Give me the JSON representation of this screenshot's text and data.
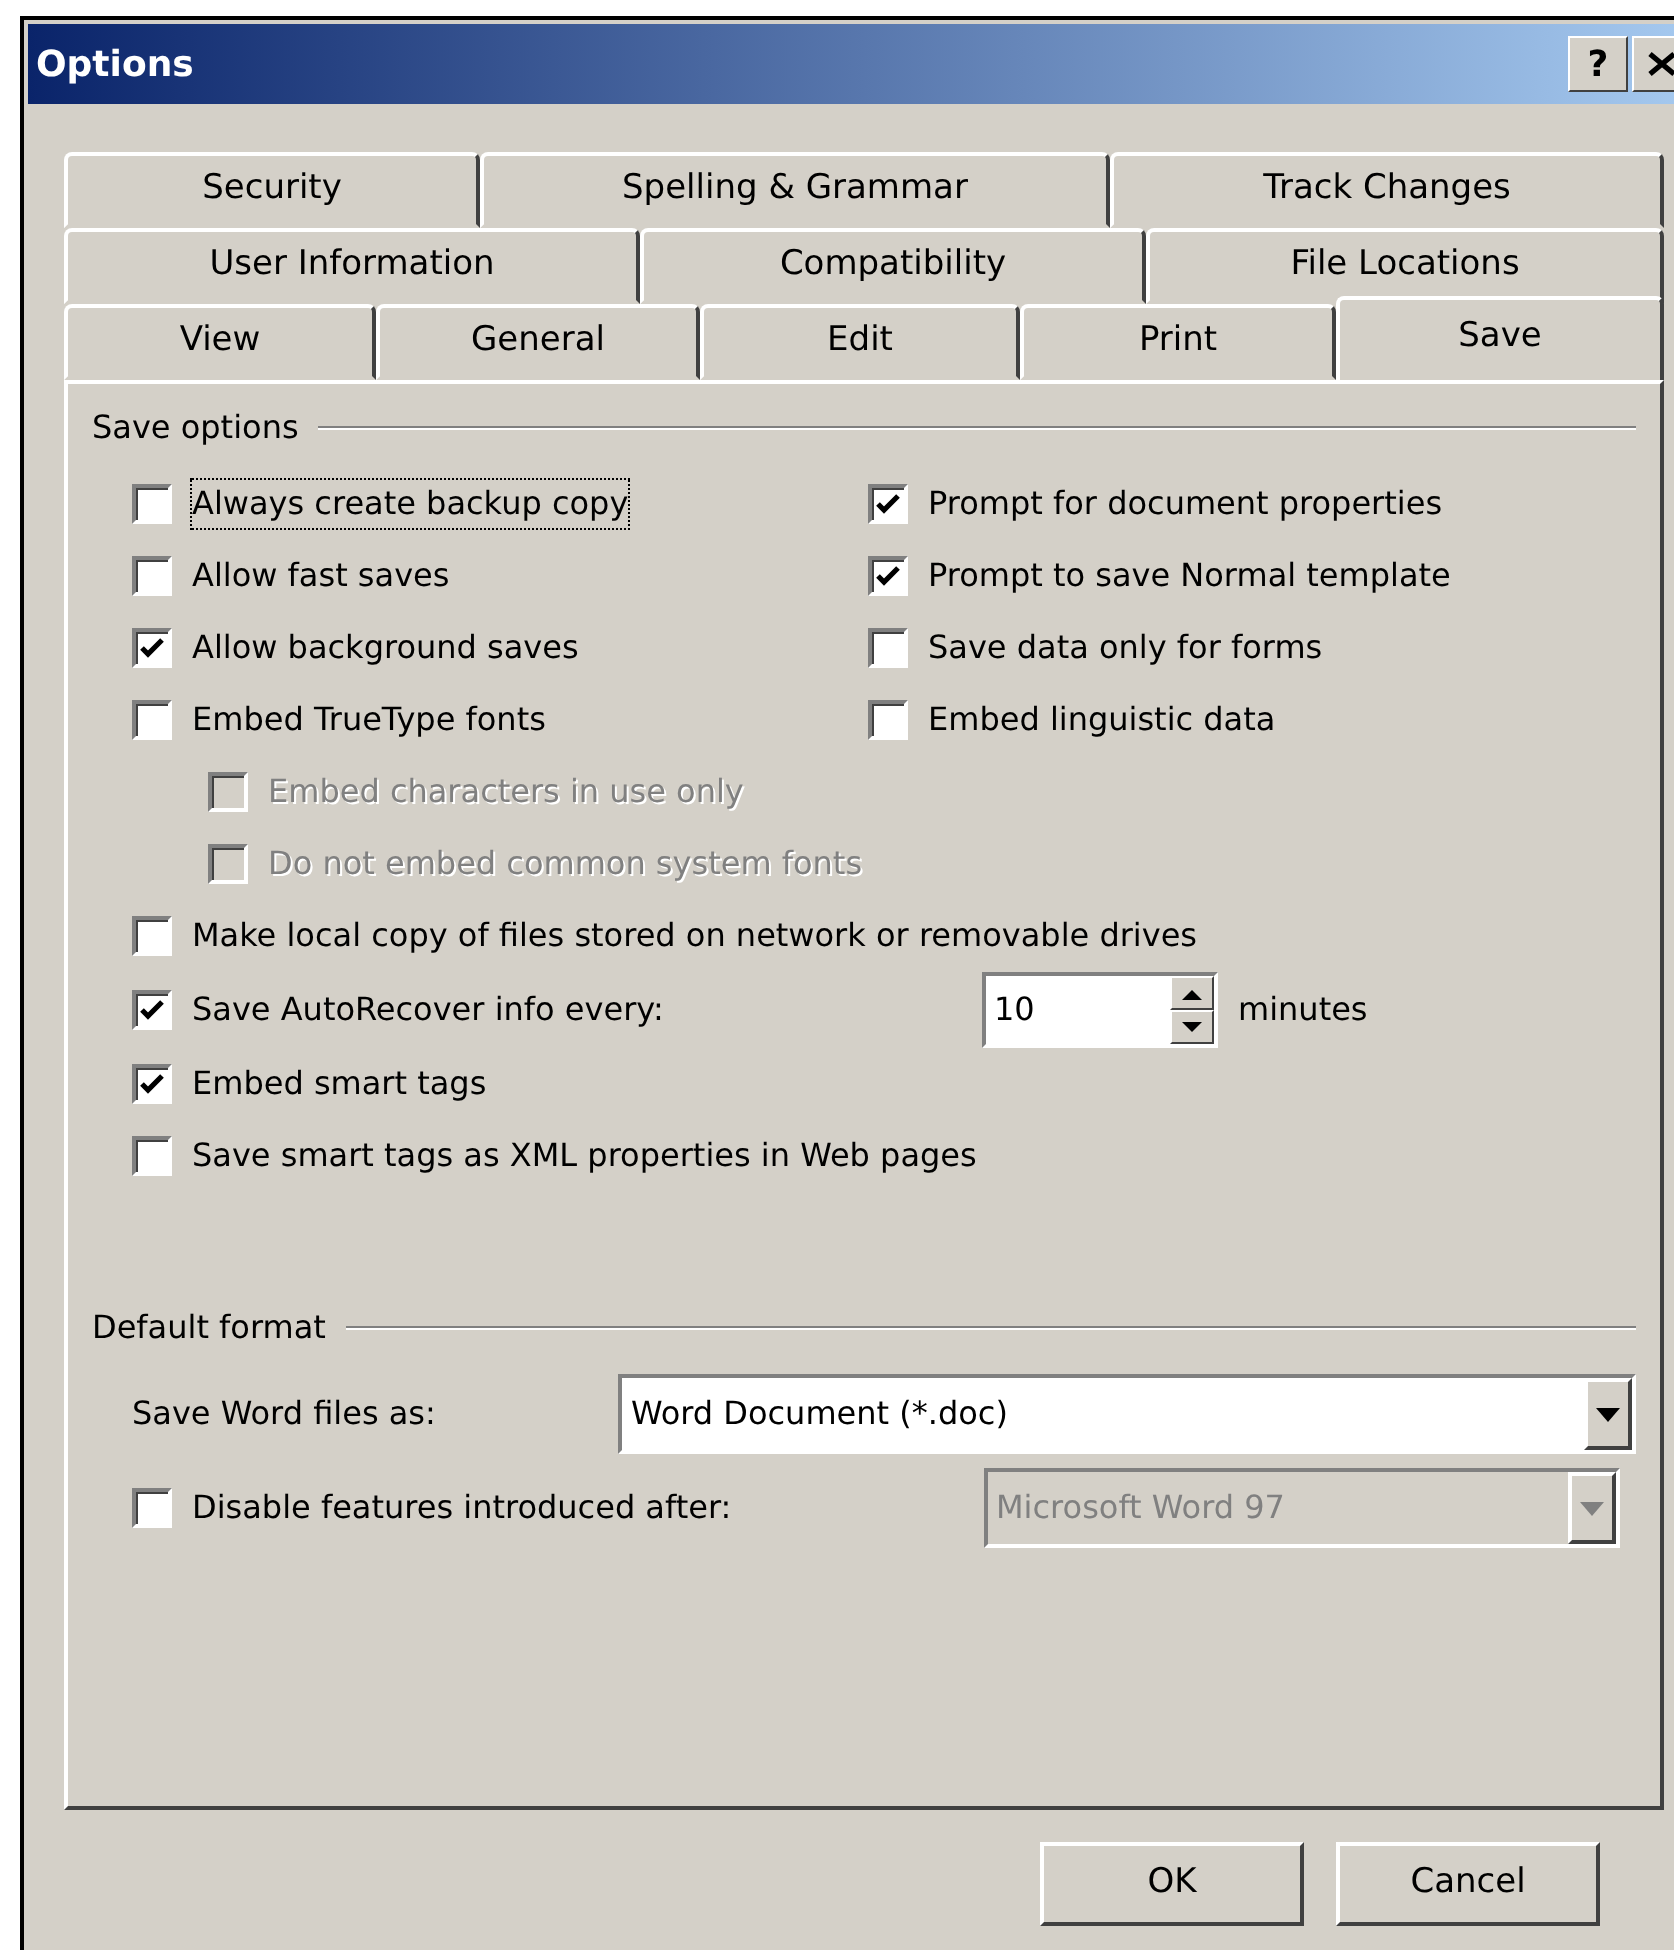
{
  "window": {
    "title": "Options",
    "help": "?"
  },
  "tab_rows": [
    [
      {
        "label": "Security",
        "selected": false
      },
      {
        "label": "Spelling & Grammar",
        "selected": false
      },
      {
        "label": "Track Changes",
        "selected": false
      }
    ],
    [
      {
        "label": "User Information",
        "selected": false
      },
      {
        "label": "Compatibility",
        "selected": false
      },
      {
        "label": "File Locations",
        "selected": false
      }
    ],
    [
      {
        "label": "View",
        "selected": false
      },
      {
        "label": "General",
        "selected": false
      },
      {
        "label": "Edit",
        "selected": false
      },
      {
        "label": "Print",
        "selected": false
      },
      {
        "label": "Save",
        "selected": true
      }
    ]
  ],
  "save_options": {
    "title": "Save options",
    "left": [
      {
        "label": "Always create backup copy",
        "checked": false,
        "disabled": false,
        "focused": true
      },
      {
        "label": "Allow fast saves",
        "checked": false,
        "disabled": false
      },
      {
        "label": "Allow background saves",
        "checked": true,
        "disabled": false
      },
      {
        "label": "Embed TrueType fonts",
        "checked": false,
        "disabled": false,
        "children": [
          {
            "label": "Embed characters in use only",
            "checked": false,
            "disabled": true
          },
          {
            "label": "Do not embed common system fonts",
            "checked": false,
            "disabled": true
          }
        ]
      }
    ],
    "right": [
      {
        "label": "Prompt for document properties",
        "checked": true,
        "disabled": false
      },
      {
        "label": "Prompt to save Normal template",
        "checked": true,
        "disabled": false
      },
      {
        "label": "Save data only for forms",
        "checked": false,
        "disabled": false
      },
      {
        "label": "Embed linguistic data",
        "checked": false,
        "disabled": false
      }
    ],
    "rows": [
      {
        "kind": "checkbox",
        "label": "Make local copy of files stored on network or removable drives",
        "checked": false,
        "disabled": false
      },
      {
        "kind": "spin",
        "label": "Save AutoRecover info every:",
        "checked": true,
        "disabled": false,
        "value": "10",
        "unit": "minutes"
      },
      {
        "kind": "checkbox",
        "label": "Embed smart tags",
        "checked": true,
        "disabled": false
      },
      {
        "kind": "checkbox",
        "label": "Save smart tags as XML properties in Web pages",
        "checked": false,
        "disabled": false
      }
    ]
  },
  "default_format": {
    "title": "Default format",
    "save_as": {
      "label": "Save Word files as:",
      "value": "Word Document (*.doc)",
      "disabled": false
    },
    "disable_features": {
      "label": "Disable features introduced after:",
      "checked": false,
      "disabled": false,
      "value": "Microsoft Word 97",
      "select_disabled": true
    }
  },
  "buttons": [
    "OK",
    "Cancel"
  ]
}
